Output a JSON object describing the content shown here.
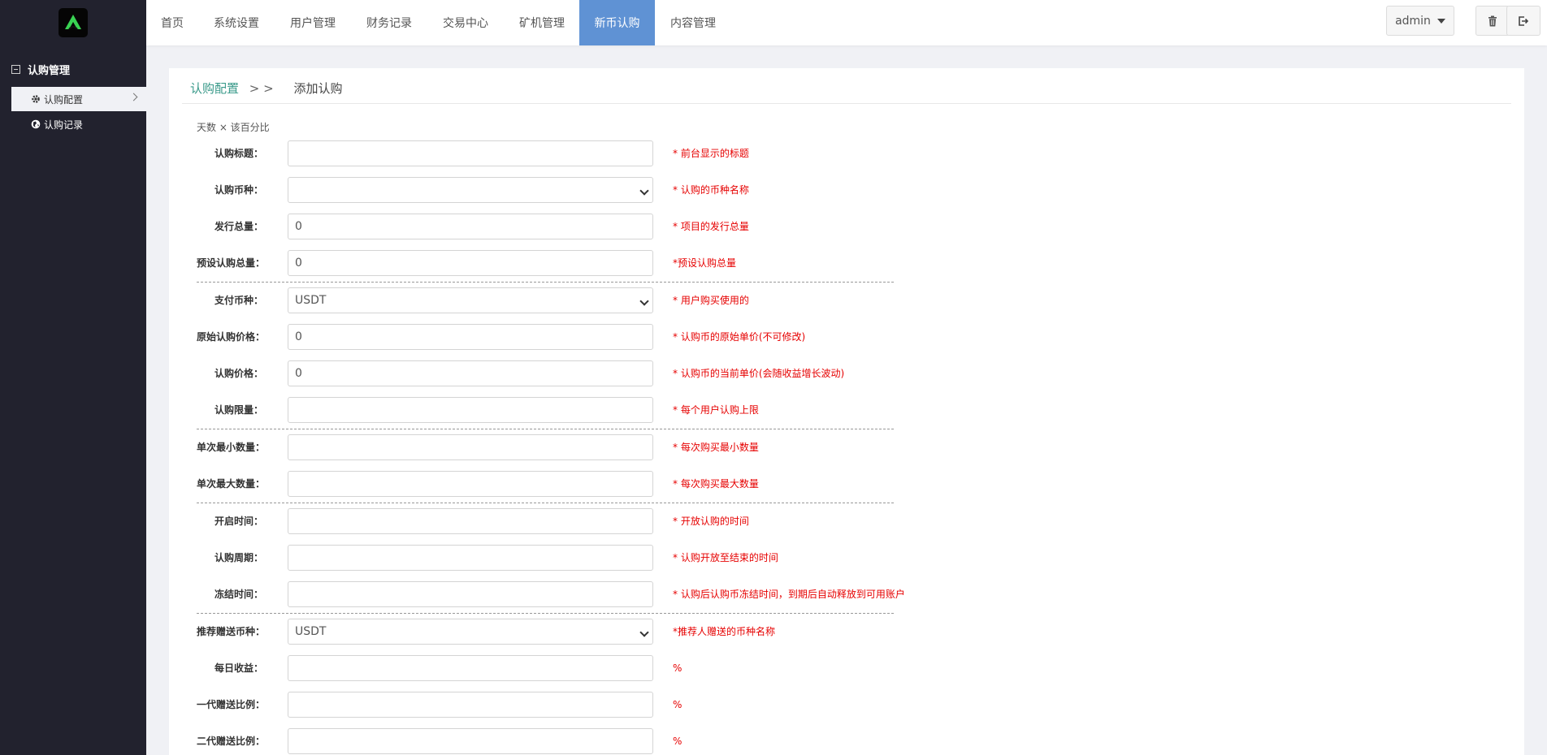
{
  "colors": {
    "sidebar_bg": "#22222e",
    "nav_active": "#5f92d4",
    "note_red": "#e60000",
    "crumb_link": "#3a9a8a"
  },
  "sidebar": {
    "logo_icon": "brand-logo",
    "group_label": "认购管理",
    "items": [
      {
        "label": "认购配置",
        "icon": "gear-icon",
        "active": true
      },
      {
        "label": "认购记录",
        "icon": "globe-icon",
        "active": false
      }
    ]
  },
  "topnav": {
    "items": [
      "首页",
      "系统设置",
      "用户管理",
      "财务记录",
      "交易中心",
      "矿机管理",
      "新币认购",
      "内容管理"
    ],
    "active": "新币认购",
    "user": "admin",
    "trash_icon": "trash-icon",
    "logout_icon": "logout-icon"
  },
  "breadcrumb": {
    "parent": "认购配置",
    "separator": "> >",
    "current": "添加认购"
  },
  "hint": "天数 × 该百分比",
  "form": [
    {
      "label": "认购标题：",
      "type": "input",
      "value": "",
      "note": "* 前台显示的标题"
    },
    {
      "label": "认购币种：",
      "type": "select",
      "value": "",
      "note": "* 认购的币种名称"
    },
    {
      "label": "发行总量：",
      "type": "input",
      "value": "0",
      "note": "* 项目的发行总量"
    },
    {
      "label": "预设认购总量：",
      "type": "input",
      "value": "0",
      "note": "*预设认购总量"
    },
    {
      "label": "支付币种：",
      "type": "select",
      "value": "USDT",
      "note": "* 用户购买使用的"
    },
    {
      "label": "原始认购价格：",
      "type": "input",
      "value": "0",
      "note": "* 认购币的原始单价(不可修改)"
    },
    {
      "label": "认购价格：",
      "type": "input",
      "value": "0",
      "note": "* 认购币的当前单价(会随收益增长波动)"
    },
    {
      "label": "认购限量：",
      "type": "input",
      "value": "",
      "note": "* 每个用户认购上限"
    },
    {
      "label": "单次最小数量：",
      "type": "input",
      "value": "",
      "note": "* 每次购买最小数量"
    },
    {
      "label": "单次最大数量：",
      "type": "input",
      "value": "",
      "note": "* 每次购买最大数量"
    },
    {
      "label": "开启时间：",
      "type": "input",
      "value": "",
      "note": "* 开放认购的时间"
    },
    {
      "label": "认购周期：",
      "type": "input",
      "value": "",
      "note": "* 认购开放至结束的时间"
    },
    {
      "label": "冻结时间：",
      "type": "input",
      "value": "",
      "note": "* 认购后认购币冻结时间，到期后自动释放到可用账户"
    },
    {
      "label": "推荐赠送币种：",
      "type": "select",
      "value": "USDT",
      "note": "*推荐人赠送的币种名称"
    },
    {
      "label": "每日收益：",
      "type": "input",
      "value": "",
      "note": "%"
    },
    {
      "label": "一代赠送比例：",
      "type": "input",
      "value": "",
      "note": "%"
    },
    {
      "label": "二代赠送比例：",
      "type": "input",
      "value": "",
      "note": "%"
    }
  ]
}
